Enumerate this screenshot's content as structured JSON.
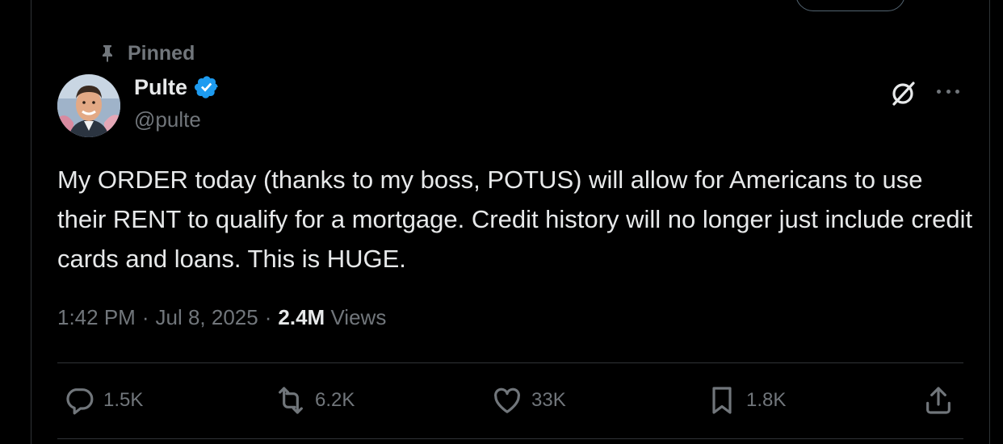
{
  "pinned": {
    "label": "Pinned"
  },
  "author": {
    "display_name": "Pulte",
    "handle": "@pulte",
    "verified": true
  },
  "tweet": {
    "text": "My ORDER today (thanks to my boss, POTUS) will allow for Americans to use their RENT to qualify for a mortgage. Credit history will no longer just include credit cards and loans. This is HUGE."
  },
  "meta": {
    "time": "1:42 PM",
    "sep1": "·",
    "date": "Jul 8, 2025",
    "sep2": "·",
    "views_count": "2.4M",
    "views_label": "Views"
  },
  "actions": {
    "replies": "1.5K",
    "reposts": "6.2K",
    "likes": "33K",
    "bookmarks": "1.8K"
  },
  "colors": {
    "background": "#000000",
    "text": "#e7e9ea",
    "muted": "#71767b",
    "verified": "#1d9bf0",
    "border": "#2f3336"
  }
}
